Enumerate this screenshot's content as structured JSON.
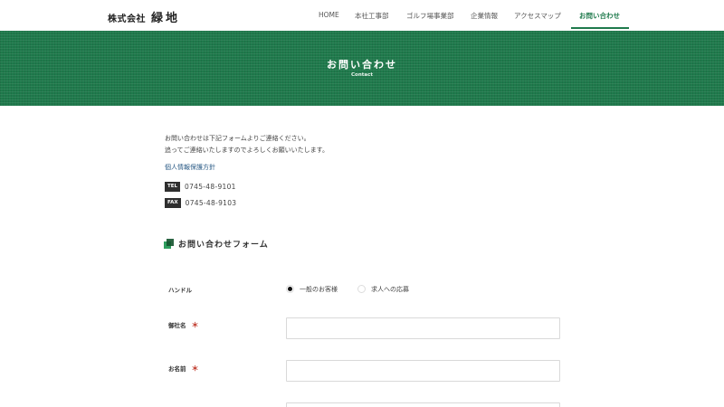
{
  "header": {
    "logo_prefix": "株式会社",
    "logo_name": "緑地",
    "nav": [
      {
        "label": "HOME"
      },
      {
        "label": "本社工事部"
      },
      {
        "label": "ゴルフ場事業部"
      },
      {
        "label": "企業情報"
      },
      {
        "label": "アクセスマップ"
      },
      {
        "label": "お問い合わせ",
        "active": true
      }
    ]
  },
  "hero": {
    "title": "お問い合わせ",
    "subtitle": "Contact"
  },
  "intro": {
    "line1": "お問い合わせは下記フォームよりご連絡ください。",
    "line2": "追ってご連絡いたしますのでよろしくお願いいたします。",
    "privacy_link": "個人情報保護方針"
  },
  "contacts": {
    "tel_tag": "TEL",
    "tel": "0745-48-9101",
    "fax_tag": "FAX",
    "fax": "0745-48-9103"
  },
  "form": {
    "heading": "お問い合わせフォーム",
    "handle_label": "ハンドル",
    "options": [
      {
        "label": "一般のお客様",
        "selected": true
      },
      {
        "label": "求人への応募",
        "selected": false
      }
    ],
    "company_label": "御社名",
    "name_label": "お名前",
    "required_mark": "＊",
    "company_value": "",
    "name_value": ""
  },
  "colors": {
    "brand_green": "#1f7a4c",
    "required_red": "#c0392b"
  }
}
